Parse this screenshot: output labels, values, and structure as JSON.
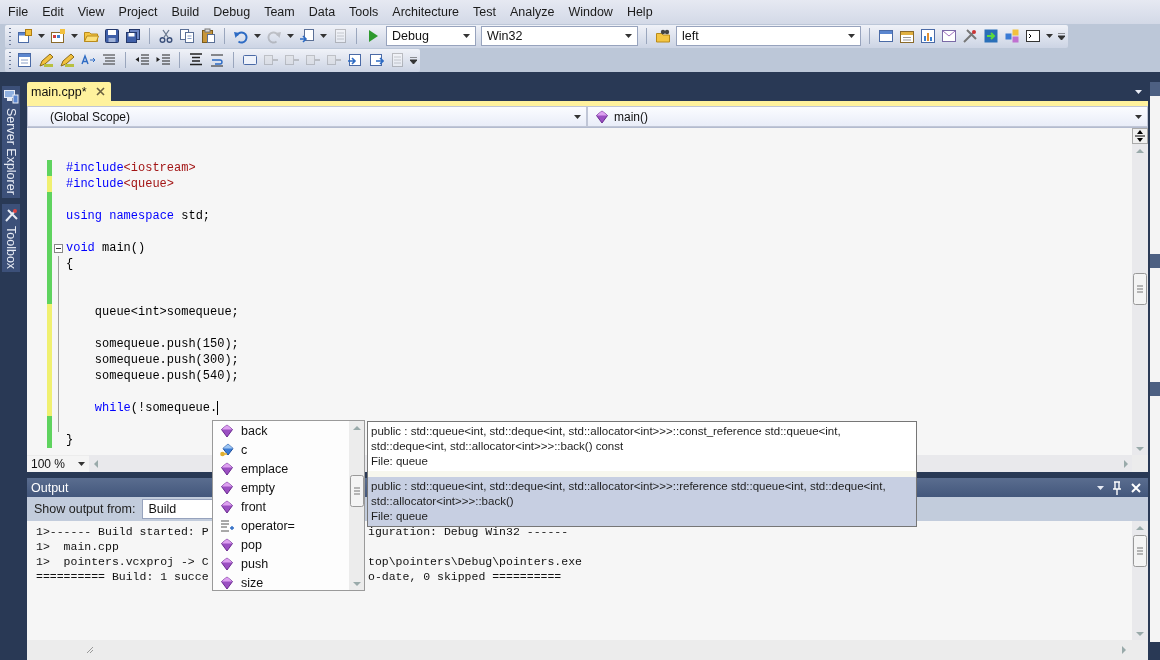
{
  "menu": [
    "File",
    "Edit",
    "View",
    "Project",
    "Build",
    "Debug",
    "Team",
    "Data",
    "Tools",
    "Architecture",
    "Test",
    "Analyze",
    "Window",
    "Help"
  ],
  "toolbar": {
    "configuration": "Debug",
    "platform": "Win32",
    "find": "left"
  },
  "side_tabs": [
    "Server Explorer",
    "Toolbox"
  ],
  "document_tabs": [
    {
      "label": "main.cpp*",
      "selected": true
    }
  ],
  "navigation": {
    "scope": "(Global Scope)",
    "member": "main()"
  },
  "code_lines": [
    {
      "saved": true,
      "tokens": [
        {
          "text": "#include",
          "kind": "directive"
        },
        {
          "text": "<iostream>",
          "kind": "header"
        }
      ]
    },
    {
      "saved": false,
      "tokens": [
        {
          "text": "#include",
          "kind": "directive"
        },
        {
          "text": "<queue>",
          "kind": "header"
        }
      ]
    },
    {
      "saved": true
    },
    {
      "saved": true,
      "tokens": [
        {
          "text": "using",
          "kind": "keyword"
        },
        {
          "text": " namespace",
          "kind": "keyword"
        },
        {
          "text": " std;",
          "kind": "plain"
        }
      ]
    },
    {
      "saved": true
    },
    {
      "saved": true,
      "expanded": true,
      "tokens": [
        {
          "text": "void",
          "kind": "keyword"
        },
        {
          "text": " main()",
          "kind": "plain"
        }
      ]
    },
    {
      "saved": true,
      "tokens": [
        {
          "text": "{",
          "kind": "plain"
        }
      ],
      "children": [
        {
          "saved": true
        },
        {
          "saved": true
        },
        {
          "saved": false,
          "tokens": [
            {
              "text": "queue<int>somequeue;",
              "kind": "plain"
            }
          ]
        },
        {
          "saved": false
        },
        {
          "saved": false,
          "tokens": [
            {
              "text": "somequeue.push(150);",
              "kind": "plain"
            }
          ]
        },
        {
          "saved": false,
          "tokens": [
            {
              "text": "somequeue.push(300);",
              "kind": "plain"
            }
          ]
        },
        {
          "saved": false,
          "tokens": [
            {
              "text": "somequeue.push(540);",
              "kind": "plain"
            }
          ]
        },
        {
          "saved": false
        },
        {
          "saved": false,
          "caret": true,
          "tokens": [
            {
              "text": "while",
              "kind": "keyword"
            },
            {
              "text": "(!somequeue.",
              "kind": "plain"
            }
          ]
        },
        {
          "saved": true
        }
      ]
    },
    {
      "saved": true,
      "tokens": [
        {
          "text": "}",
          "kind": "plain"
        }
      ]
    }
  ],
  "zoom": "100 %",
  "completion_list": [
    {
      "label": "back",
      "kind": "method"
    },
    {
      "label": "c",
      "kind": "field"
    },
    {
      "label": "emplace",
      "kind": "method"
    },
    {
      "label": "empty",
      "kind": "method"
    },
    {
      "label": "front",
      "kind": "method"
    },
    {
      "label": "operator=",
      "kind": "operator"
    },
    {
      "label": "pop",
      "kind": "method"
    },
    {
      "label": "push",
      "kind": "method"
    },
    {
      "label": "size",
      "kind": "method"
    }
  ],
  "quick_info": [
    {
      "signature": "public : std::queue<int, std::deque<int, std::allocator<int>>>::const_reference std::queue<int, std::deque<int, std::allocator<int>>>::back() const",
      "file": "File: queue",
      "selected": false
    },
    {
      "signature": "public : std::queue<int, std::deque<int, std::allocator<int>>>::reference std::queue<int, std::deque<int, std::allocator<int>>>::back()",
      "file": "File: queue",
      "selected": true
    }
  ],
  "output": {
    "title": "Output",
    "source_label": "Show output from:",
    "source": "Build",
    "lines": [
      {
        "left": "1>------ Build started: P",
        "right": "iguration: Debug Win32 ------"
      },
      {
        "left": "1>  main.cpp"
      },
      {
        "left": "1>  pointers.vcxproj -> C",
        "right": "top\\pointers\\Debug\\pointers.exe"
      },
      {
        "left": "========== Build: 1 succe",
        "right": "o-date, 0 skipped =========="
      }
    ]
  }
}
